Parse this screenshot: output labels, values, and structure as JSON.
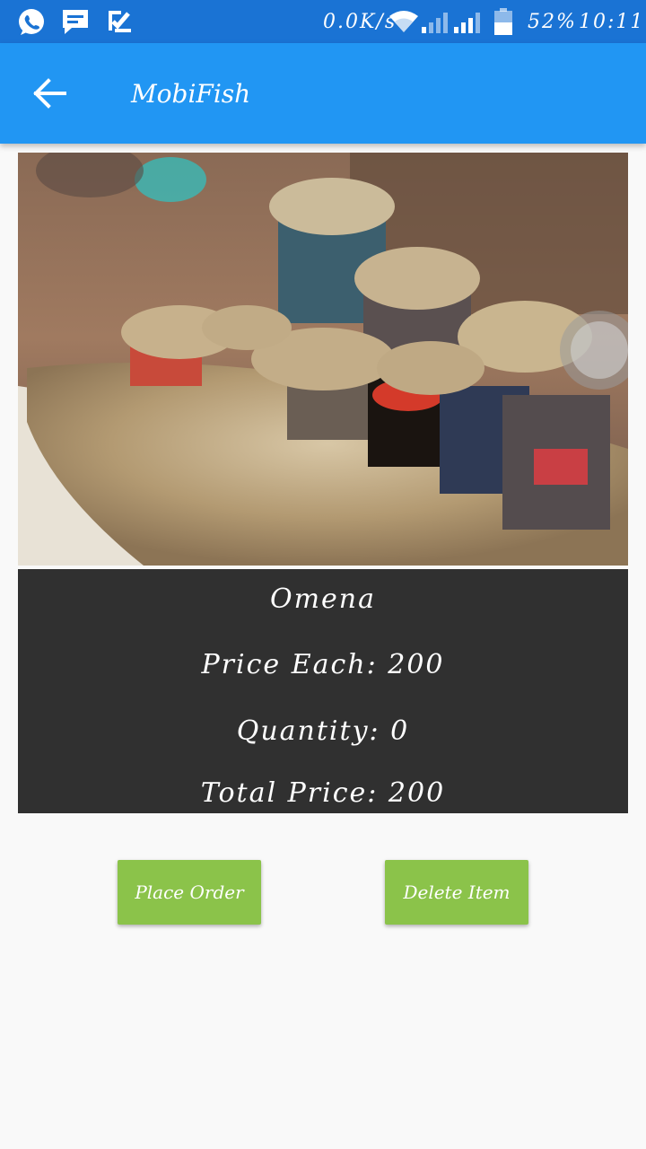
{
  "status_bar": {
    "net_speed": "0.0K/s",
    "battery": "52%",
    "time": "10:11",
    "icons": [
      "whatsapp-icon",
      "message-icon",
      "checklist-icon",
      "wifi-icon",
      "signal-icon",
      "signal-icon-2",
      "battery-icon"
    ]
  },
  "app_bar": {
    "title": "MobiFish",
    "back_icon": "arrow-left-icon",
    "color": "#2196f3"
  },
  "product": {
    "image": "dried-omena-fish-market-photo",
    "name": "Omena",
    "price_each": "Price Each: 200",
    "quantity": "Quantity: 0",
    "total_price": "Total Price: 200"
  },
  "actions": {
    "place_order": "Place Order",
    "delete_item": "Delete Item",
    "color": "#8bc34a"
  }
}
